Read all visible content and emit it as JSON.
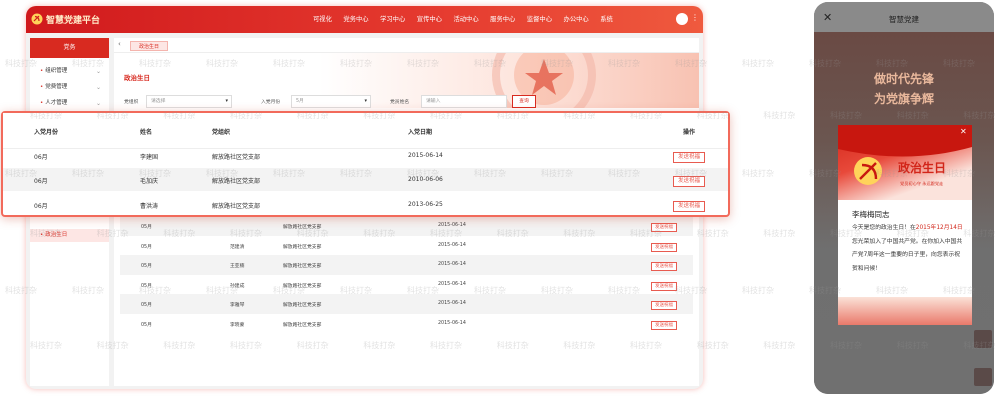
{
  "desktop": {
    "brand": "智慧党建平台",
    "nav": [
      "可视化",
      "党务中心",
      "学习中心",
      "宣传中心",
      "活动中心",
      "服务中心",
      "监督中心",
      "办公中心",
      "系统"
    ],
    "sidebar": {
      "header": "党务",
      "items": [
        "组织管理",
        "党费管理",
        "人才管理",
        "政治生日"
      ],
      "active_index": 3
    },
    "tab_active": "政治生日",
    "page_title": "政治生日",
    "filters": {
      "org_label": "党组织",
      "org_placeholder": "请选择",
      "month_label": "入党月份",
      "month_value": "5月",
      "name_label": "党员姓名",
      "name_placeholder": "请输入",
      "search_button": "查询"
    },
    "small_rows": [
      {
        "month": "05月",
        "name": "",
        "org": "解放路社区党支部",
        "date": "2015-06-14",
        "action": "发送祝福"
      },
      {
        "month": "05月",
        "name": "范建清",
        "org": "解放路社区党支部",
        "date": "2015-06-14",
        "action": "发送祝福"
      },
      {
        "month": "05月",
        "name": "王亚楠",
        "org": "解放路社区党支部",
        "date": "2015-06-14",
        "action": "发送祝福"
      },
      {
        "month": "05月",
        "name": "孙建成",
        "org": "解放路社区党支部",
        "date": "2015-06-14",
        "action": "发送祝福"
      },
      {
        "month": "05月",
        "name": "李雅琴",
        "org": "解放路社区党支部",
        "date": "2015-06-14",
        "action": "发送祝福"
      },
      {
        "month": "05月",
        "name": "李晓蒙",
        "org": "解放路社区党支部",
        "date": "2015-06-14",
        "action": "发送祝福"
      }
    ]
  },
  "zoom_table": {
    "headers": [
      "入党月份",
      "姓名",
      "党组织",
      "入党日期",
      "操作"
    ],
    "rows": [
      {
        "month": "06月",
        "name": "李建国",
        "org": "解放路社区党支部",
        "date": "2015-06-14",
        "action": "发送祝福"
      },
      {
        "month": "06月",
        "name": "毛加庆",
        "org": "解放路社区党支部",
        "date": "2010-06-06",
        "action": "发送祝福"
      },
      {
        "month": "06月",
        "name": "曹洪涛",
        "org": "解放路社区党支部",
        "date": "2013-06-25",
        "action": "发送祝福"
      }
    ]
  },
  "phone": {
    "title": "智慧党建",
    "slogan_1": "做时代先锋",
    "slogan_2": "为党旗争辉",
    "modal": {
      "title": "政治生日",
      "subtitle": "党员初心守  永远跟党走",
      "greeting": "李梅梅同志",
      "msg_1": "今天是您的政治生日！在",
      "msg_date": "2015年12月14日",
      "msg_2": "您光荣加入了中国共产党。在你加入中国共产党7周年这一重要的日子里，向您表示祝贺和问候！"
    }
  },
  "watermark": "科技打杂",
  "colors": {
    "brand_red": "#d82a20",
    "highlight_border": "#f26a5b"
  }
}
